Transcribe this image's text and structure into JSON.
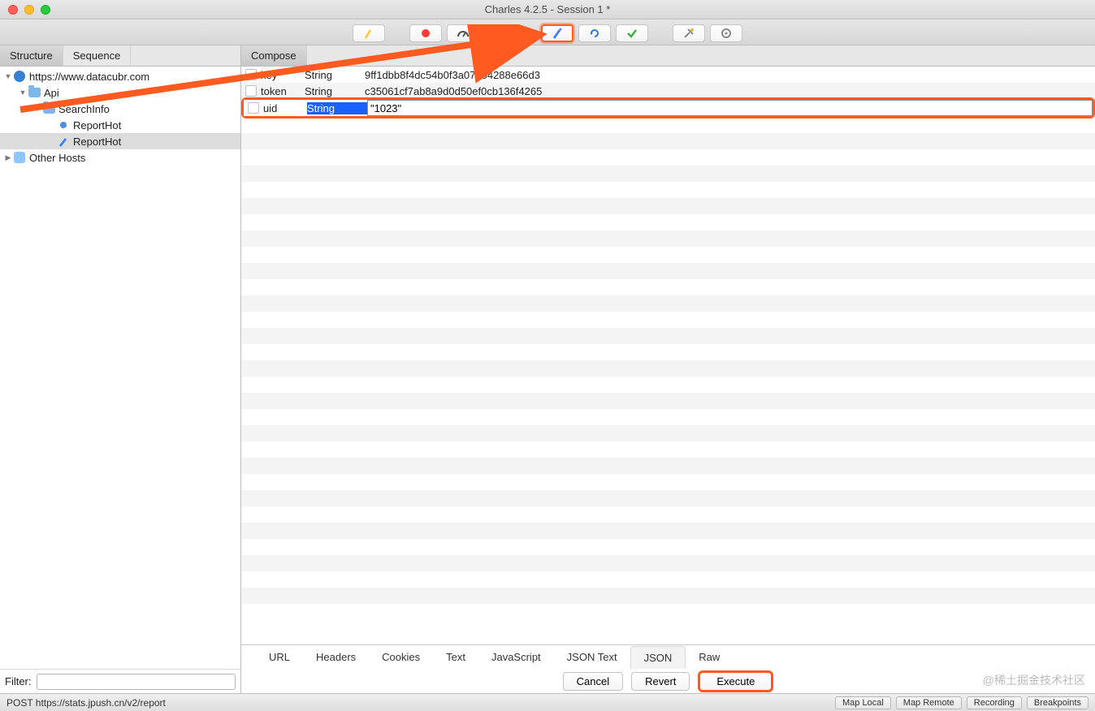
{
  "window": {
    "title": "Charles 4.2.5 - Session 1 *"
  },
  "leftTabs": {
    "structure": "Structure",
    "sequence": "Sequence"
  },
  "tree": {
    "root": "https://www.datacubr.com",
    "api": "Api",
    "searchinfo": "SearchInfo",
    "report1": "ReportHot",
    "report2": "ReportHot",
    "otherhosts": "Other Hosts"
  },
  "filter": {
    "label": "Filter:",
    "value": ""
  },
  "mainTabs": {
    "compose": "Compose"
  },
  "gridRows": [
    {
      "key": "key",
      "type": "String",
      "value": "9ff1dbb8f4dc54b0f3a07504288e66d3"
    },
    {
      "key": "token",
      "type": "String",
      "value": "c35061cf7ab8a9d0d50ef0cb136f4265"
    },
    {
      "key": "uid",
      "type": "String",
      "value": "\"1023\""
    }
  ],
  "bottomTabs": {
    "url": "URL",
    "headers": "Headers",
    "cookies": "Cookies",
    "text": "Text",
    "javascript": "JavaScript",
    "jsontext": "JSON Text",
    "json": "JSON",
    "raw": "Raw"
  },
  "buttons": {
    "cancel": "Cancel",
    "revert": "Revert",
    "execute": "Execute"
  },
  "status": {
    "text": "POST https://stats.jpush.cn/v2/report",
    "maplocal": "Map Local",
    "mapremote": "Map Remote",
    "recording": "Recording",
    "breakpoints": "Breakpoints"
  },
  "watermark": "@稀土掘金技术社区"
}
